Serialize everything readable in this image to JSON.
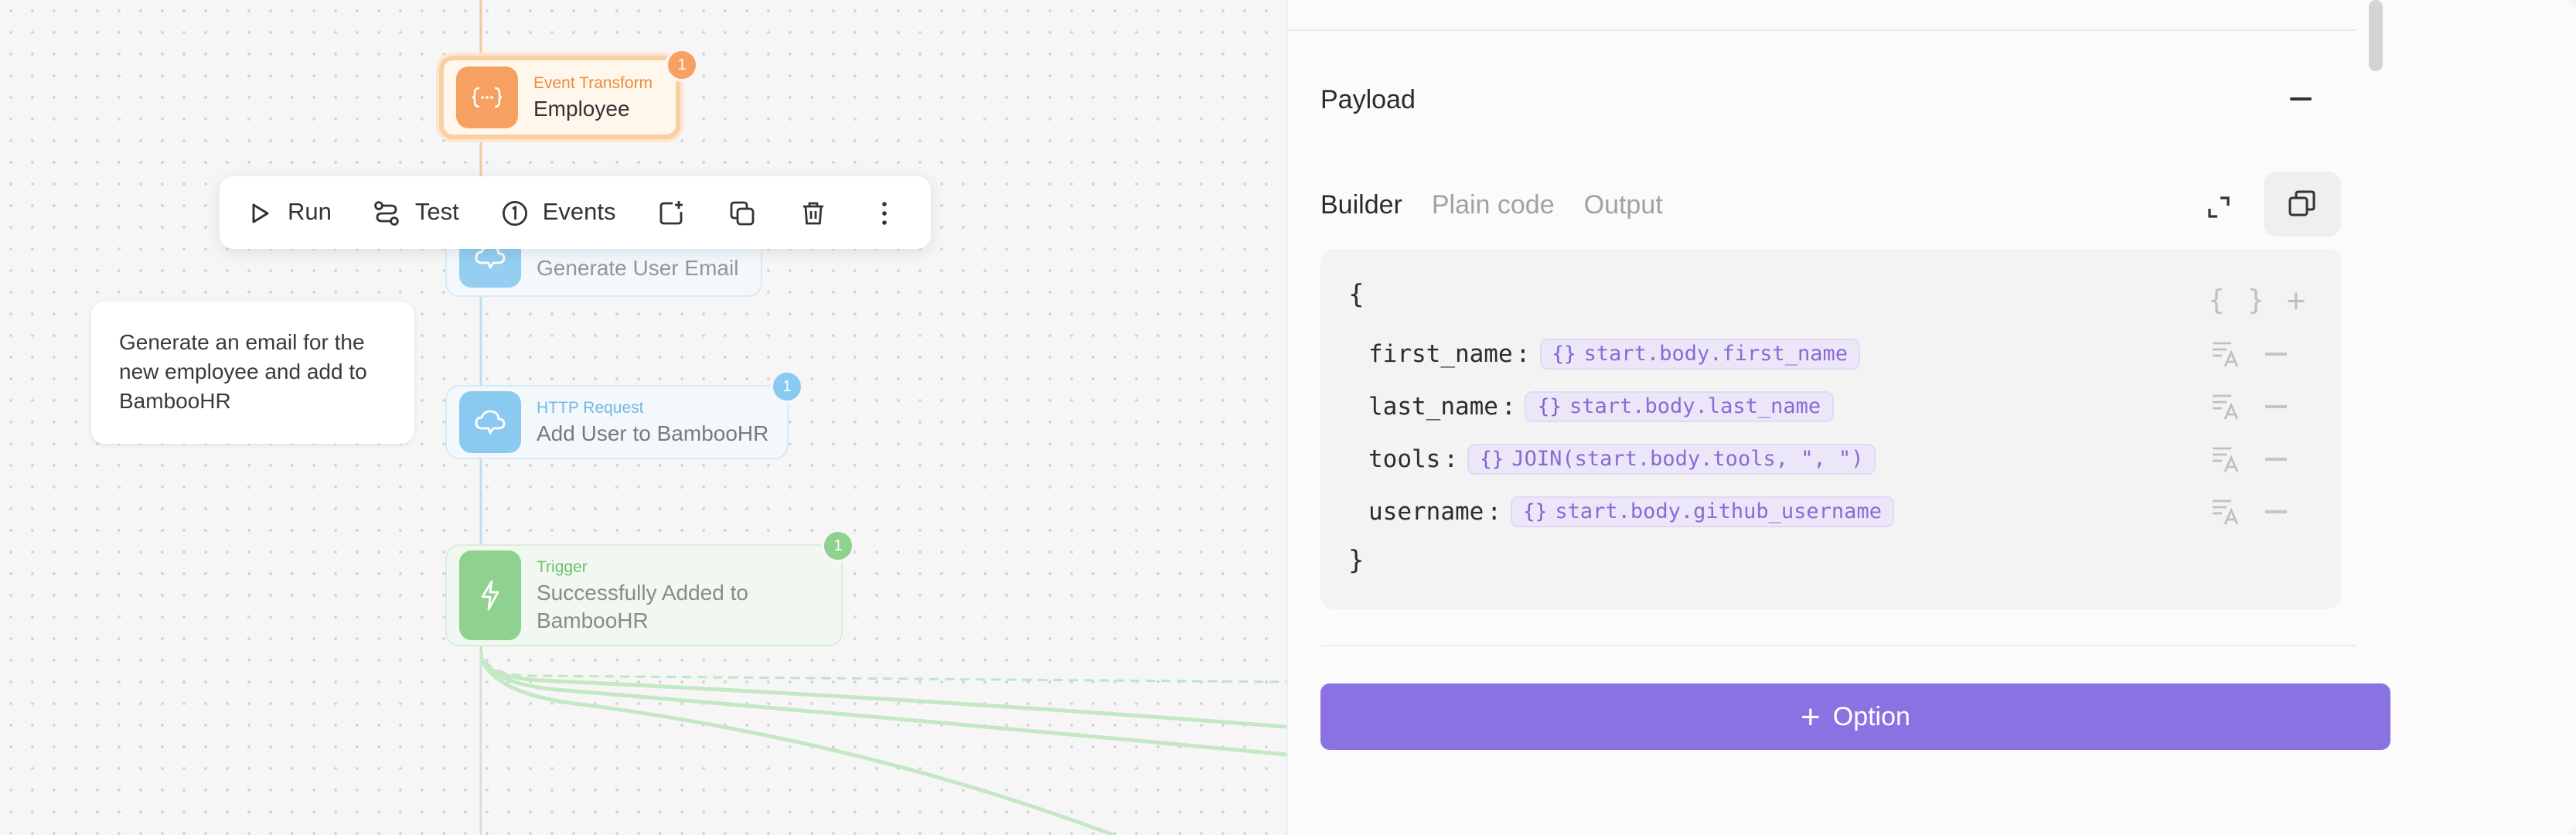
{
  "canvas": {
    "nodes": [
      {
        "id": "transform",
        "type": "Event Transform",
        "title": "Employee",
        "badge": "1",
        "icon": "braces-dots-icon",
        "color": "#f6a161"
      },
      {
        "id": "email",
        "type": "",
        "title": "Generate User Email",
        "icon": "cloud-icon",
        "color": "#8bcaf0"
      },
      {
        "id": "http",
        "type": "HTTP Request",
        "title": "Add User to BambooHR",
        "badge": "1",
        "icon": "cloud-icon",
        "color": "#8bcaf0"
      },
      {
        "id": "trigger",
        "type": "Trigger",
        "title_line1": "Successfully Added to",
        "title_line2": "BambooHR",
        "badge": "1",
        "icon": "lightning-icon",
        "color": "#8fd18f"
      }
    ],
    "note": {
      "line1": "Generate an email for the",
      "line2": "new employee and add to",
      "line3": "BambooHR"
    },
    "toolbar": {
      "run_label": "Run",
      "test_label": "Test",
      "events_label": "Events"
    }
  },
  "panel": {
    "section_title": "Payload",
    "tabs": [
      {
        "label": "Builder",
        "active": true
      },
      {
        "label": "Plain code",
        "active": false
      },
      {
        "label": "Output",
        "active": false
      }
    ],
    "code": {
      "open_brace": "{",
      "close_brace": "}",
      "obj_symbol": "{ }",
      "expr_symbol": "{}",
      "fields": [
        {
          "key": "first_name",
          "value": "start.body.first_name"
        },
        {
          "key": "last_name",
          "value": "start.body.last_name"
        },
        {
          "key": "tools",
          "value": "JOIN(start.body.tools, \", \")"
        },
        {
          "key": "username",
          "value": "start.body.github_username"
        }
      ]
    },
    "option_button": {
      "label": "Option",
      "symbol": "+"
    }
  },
  "colors": {
    "accent": "#8a72e2",
    "transform": "#f6a161",
    "http": "#8bcaf0",
    "trigger": "#8fd18f",
    "expression_text": "#8a6ad6"
  }
}
